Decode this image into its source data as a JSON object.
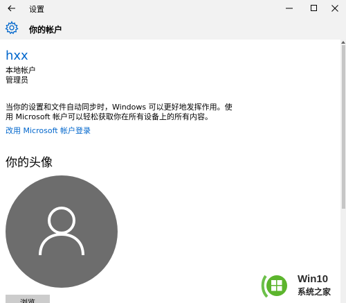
{
  "titlebar": {
    "title": "设置",
    "back_icon": "arrow-left-icon",
    "minimize_icon": "minimize-icon",
    "maximize_icon": "maximize-icon",
    "close_icon": "close-icon"
  },
  "header": {
    "icon": "gear-icon",
    "title": "你的帐户"
  },
  "account": {
    "username": "hxx",
    "type": "本地帐户",
    "role": "管理员"
  },
  "sync_message": "当你的设置和文件自动同步时，Windows 可以更好地发挥作用。使用 Microsoft 帐户可以轻松获取你在所有设备上的所有内容。",
  "ms_link": "改用 Microsoft 帐户登录",
  "avatar_section": {
    "heading": "你的头像",
    "avatar_icon": "user-silhouette-icon",
    "browse_button": "浏览"
  },
  "watermark": {
    "logo_icon": "windows-logo-icon",
    "line1": "Win10",
    "line2": "系统之家"
  },
  "colors": {
    "accent": "#0066cc",
    "avatar_bg": "#6d6d6d",
    "titlebar_bg": "#f2f2f2"
  }
}
